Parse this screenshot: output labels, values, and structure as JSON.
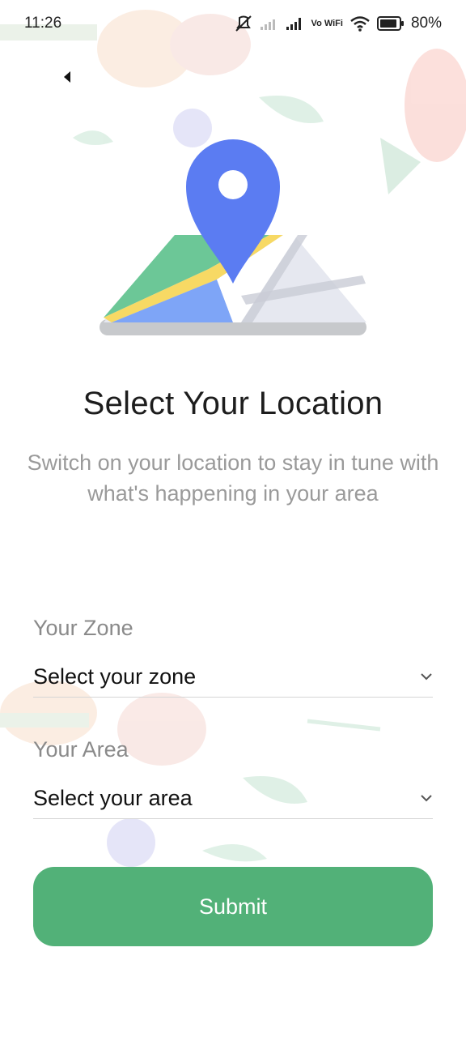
{
  "status_bar": {
    "time": "11:26",
    "network_label": "Vo WiFi",
    "battery_percent": "80%",
    "icons": [
      "mute-vibrate-icon",
      "signal-off-icon",
      "signal-icon",
      "vowifi-icon",
      "wifi-icon",
      "battery-icon"
    ]
  },
  "nav": {
    "back_icon": "back-arrow-icon"
  },
  "hero": {
    "illustration_icon": "map-pin-icon"
  },
  "title": "Select Your Location",
  "subtitle": "Switch on your location to stay in tune with what's happening in your area",
  "form": {
    "zone": {
      "label": "Your Zone",
      "placeholder": "Select your zone"
    },
    "area": {
      "label": "Your Area",
      "placeholder": "Select your area"
    }
  },
  "submit_label": "Submit",
  "colors": {
    "accent": "#52b178",
    "pin_blue": "#5b7cf2",
    "title_text": "#1d1d1d",
    "muted_text": "#9a9a9a"
  }
}
